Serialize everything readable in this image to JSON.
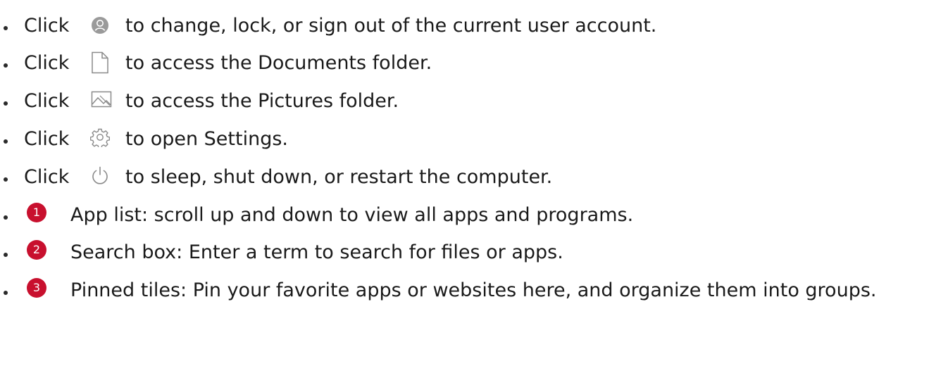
{
  "items": [
    {
      "click": "Click",
      "icon": "user-icon",
      "text": "to change, lock, or sign out of the current user account."
    },
    {
      "click": "Click",
      "icon": "document-icon",
      "text": "to access the Documents folder."
    },
    {
      "click": "Click",
      "icon": "pictures-icon",
      "text": "to access the Pictures folder."
    },
    {
      "click": "Click",
      "icon": "settings-gear-icon",
      "text": "to open Settings."
    },
    {
      "click": "Click",
      "icon": "power-icon",
      "text": "to sleep, shut down, or restart the computer."
    }
  ],
  "callouts": [
    {
      "number": "1",
      "text": "App list: scroll up and down to view all apps and programs."
    },
    {
      "number": "2",
      "text": "Search box: Enter a term to search for files or apps."
    },
    {
      "number": "3",
      "text": "Pinned tiles: Pin your favorite apps or websites here, and organize them into groups."
    }
  ],
  "colors": {
    "badge": "#c8102e",
    "icon": "#8a8a8a"
  }
}
